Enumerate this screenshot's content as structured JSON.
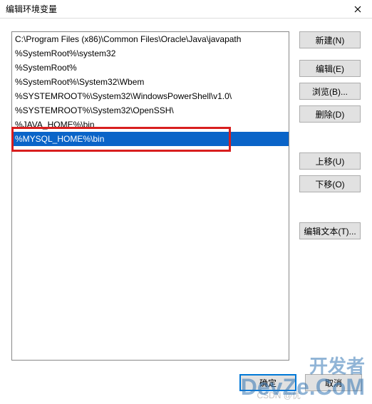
{
  "titlebar": {
    "title": "编辑环境变量"
  },
  "list": {
    "items": [
      "C:\\Program Files (x86)\\Common Files\\Oracle\\Java\\javapath",
      "%SystemRoot%\\system32",
      "%SystemRoot%",
      "%SystemRoot%\\System32\\Wbem",
      "%SYSTEMROOT%\\System32\\WindowsPowerShell\\v1.0\\",
      "%SYSTEMROOT%\\System32\\OpenSSH\\",
      "%JAVA_HOME%\\bin",
      "%MYSQL_HOME%\\bin"
    ],
    "selected_index": 7
  },
  "buttons": {
    "new": "新建(N)",
    "edit": "编辑(E)",
    "browse": "浏览(B)...",
    "delete": "删除(D)",
    "move_up": "上移(U)",
    "move_down": "下移(O)",
    "edit_text": "编辑文本(T)..."
  },
  "footer": {
    "ok": "确定",
    "cancel": "取消"
  },
  "watermarks": {
    "csdn": "CSDN @优",
    "devze_line1": "开发者",
    "devze_line2": "DevZe.CoM"
  }
}
